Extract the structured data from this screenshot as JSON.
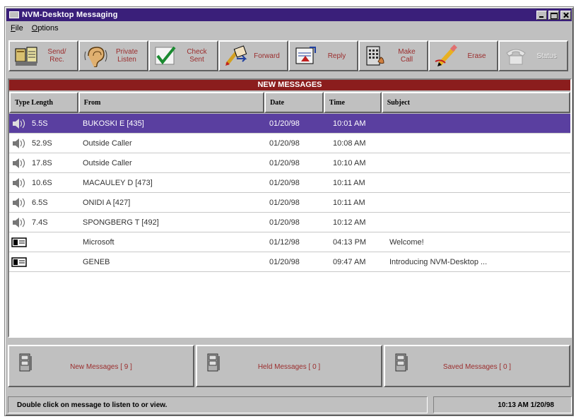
{
  "window": {
    "title": "NVM-Desktop Messaging"
  },
  "menu": {
    "file": "File",
    "options": "Options"
  },
  "toolbar": [
    {
      "id": "send-rec",
      "label": "Send/\nRec.",
      "icon": "send-receive-icon",
      "enabled": true
    },
    {
      "id": "private-listen",
      "label": "Private\nListen",
      "icon": "ear-icon",
      "enabled": true
    },
    {
      "id": "check-sent",
      "label": "Check\nSent",
      "icon": "checkmark-icon",
      "enabled": true
    },
    {
      "id": "forward",
      "label": "Forward",
      "icon": "forward-icon",
      "enabled": true
    },
    {
      "id": "reply",
      "label": "Reply",
      "icon": "reply-icon",
      "enabled": true
    },
    {
      "id": "make-call",
      "label": "Make\nCall",
      "icon": "phone-keypad-icon",
      "enabled": true
    },
    {
      "id": "erase",
      "label": "Erase",
      "icon": "eraser-icon",
      "enabled": true
    },
    {
      "id": "status",
      "label": "Status",
      "icon": "telephone-icon",
      "enabled": false
    }
  ],
  "list": {
    "banner": "NEW MESSAGES",
    "headers": {
      "type_length": "Type  Length",
      "from": "From",
      "date": "Date",
      "time": "Time",
      "subject": "Subject"
    },
    "rows": [
      {
        "type": "voice",
        "length": "5.5S",
        "from": "BUKOSKI E [435]",
        "date": "01/20/98",
        "time": "10:01 AM",
        "subject": "",
        "selected": true
      },
      {
        "type": "voice",
        "length": "52.9S",
        "from": "Outside Caller",
        "date": "01/20/98",
        "time": "10:08 AM",
        "subject": ""
      },
      {
        "type": "voice",
        "length": "17.8S",
        "from": "Outside Caller",
        "date": "01/20/98",
        "time": "10:10 AM",
        "subject": ""
      },
      {
        "type": "voice",
        "length": "10.6S",
        "from": "MACAULEY D [473]",
        "date": "01/20/98",
        "time": "10:11 AM",
        "subject": ""
      },
      {
        "type": "voice",
        "length": "6.5S",
        "from": "ONIDI A [427]",
        "date": "01/20/98",
        "time": "10:11 AM",
        "subject": ""
      },
      {
        "type": "voice",
        "length": "7.4S",
        "from": "SPONGBERG T [492]",
        "date": "01/20/98",
        "time": "10:12 AM",
        "subject": ""
      },
      {
        "type": "text",
        "length": "",
        "from": "Microsoft",
        "date": "01/12/98",
        "time": "04:13 PM",
        "subject": "Welcome!"
      },
      {
        "type": "text",
        "length": "",
        "from": "GENEB",
        "date": "01/20/98",
        "time": "09:47 AM",
        "subject": "Introducing NVM-Desktop ..."
      }
    ]
  },
  "folders": [
    {
      "id": "new",
      "label": "New Messages [ 9 ]"
    },
    {
      "id": "held",
      "label": "Held Messages [ 0 ]"
    },
    {
      "id": "saved",
      "label": "Saved Messages [ 0 ]"
    }
  ],
  "status": {
    "message": "Double click on message to listen to or view.",
    "clock": "10:13 AM 1/20/98"
  },
  "colors": {
    "titlebar": "#3a1f7a",
    "banner": "#8b1d1d",
    "selection": "#5a3fa0",
    "button_text": "#9b2d2d"
  }
}
